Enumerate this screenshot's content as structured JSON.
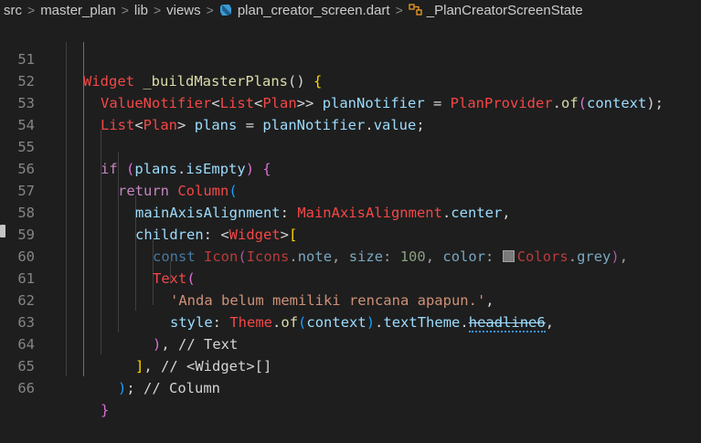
{
  "breadcrumb": {
    "items": [
      "src",
      "master_plan",
      "lib",
      "views",
      "plan_creator_screen.dart",
      "_PlanCreatorScreenState"
    ],
    "separator": ">"
  },
  "editor": {
    "line_numbers": [
      "51",
      "52",
      "53",
      "54",
      "55",
      "56",
      "57",
      "58",
      "59",
      "60",
      "61",
      "62",
      "63",
      "64",
      "65",
      "66"
    ],
    "lines": {
      "l51": {
        "t1": "Widget",
        "t2": " ",
        "t3": "_buildMasterPlans",
        "t4": "() ",
        "t5": "{"
      },
      "l52": {
        "t1": "ValueNotifier",
        "t2": "<",
        "t3": "List",
        "t4": "<",
        "t5": "Plan",
        "t6": ">>",
        "t7": " ",
        "t8": "planNotifier",
        "t9": " = ",
        "t10": "PlanProvider",
        "t11": ".",
        "t12": "of",
        "t13": "(",
        "t14": "context",
        "t15": ");"
      },
      "l53": {
        "t1": "List",
        "t2": "<",
        "t3": "Plan",
        "t4": ">",
        "t5": " ",
        "t6": "plans",
        "t7": " = ",
        "t8": "planNotifier",
        "t9": ".",
        "t10": "value",
        "t11": ";"
      },
      "l55": {
        "t1": "if",
        "t2": " ",
        "t3": "(",
        "t4": "plans",
        "t5": ".",
        "t6": "isEmpty",
        "t7": ")",
        "t8": " ",
        "t9": "{"
      },
      "l56": {
        "t1": "return",
        "t2": " ",
        "t3": "Column",
        "t4": "("
      },
      "l57": {
        "t1": "mainAxisAlignment",
        "t2": ": ",
        "t3": "MainAxisAlignment",
        "t4": ".",
        "t5": "center",
        "t6": ","
      },
      "l58": {
        "t1": "children",
        "t2": ": ",
        "t3": "<",
        "t4": "Widget",
        "t5": ">",
        "t6": "["
      },
      "l59": {
        "t1": "const",
        "t2": " ",
        "t3": "Icon",
        "t4": "(",
        "t5": "Icons",
        "t6": ".",
        "t7": "note",
        "t8": ", ",
        "t9": "size",
        "t10": ": ",
        "t11": "100",
        "t12": ", ",
        "t13": "color",
        "t14": ": ",
        "t15": "Colors",
        "t16": ".",
        "t17": "grey",
        "t18": ")",
        "t19": ","
      },
      "l60": {
        "t1": "Text",
        "t2": "("
      },
      "l61": {
        "t1": "'Anda belum memiliki rencana apapun.'",
        "t2": ","
      },
      "l62": {
        "t1": "style",
        "t2": ": ",
        "t3": "Theme",
        "t4": ".",
        "t5": "of",
        "t6": "(",
        "t7": "context",
        "t8": ")",
        "t9": ".",
        "t10": "textTheme",
        "t11": ".",
        "t12": "headline6",
        "t13": ","
      },
      "l63": {
        "t1": ")",
        "t2": ", ",
        "t3": "// Text"
      },
      "l64": {
        "t1": "]",
        "t2": ", ",
        "t3": "// <Widget>[]"
      },
      "l65": {
        "t1": ")",
        "t2": "; ",
        "t3": "// Column"
      },
      "l66": {
        "t1": "}"
      }
    }
  },
  "colors": {
    "background": "#1e1e1e",
    "keyword": "#569cd6",
    "control": "#c586c0",
    "type_error": "#f44747",
    "function": "#dcdcaa",
    "variable": "#9cdcfe",
    "string": "#ce9178",
    "number": "#b5cea8",
    "swatch_grey": "#9e9e9e"
  },
  "icons": [
    "dart-file-icon",
    "class-symbol-icon",
    "color-swatch-icon"
  ]
}
